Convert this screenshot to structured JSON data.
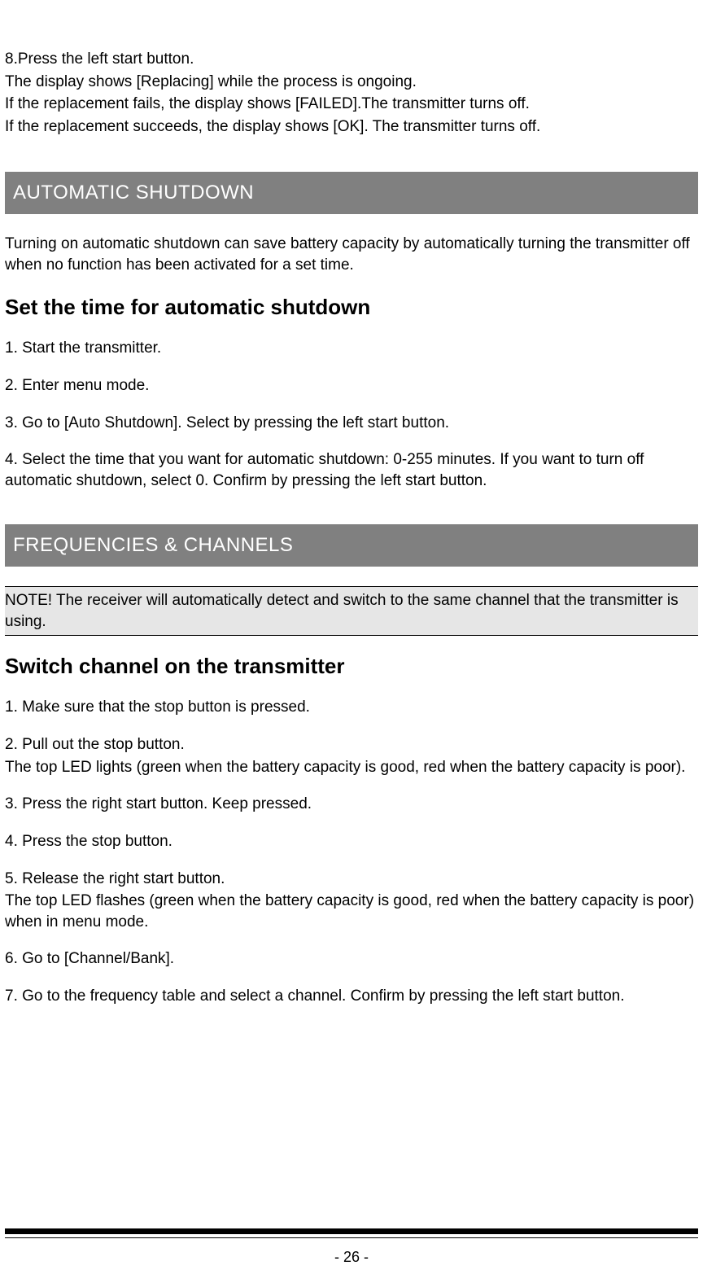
{
  "intro": {
    "lines": [
      "8.Press the left start button.",
      "The display shows [Replacing] while the process is ongoing.",
      "If the replacement fails, the display shows [FAILED].The transmitter turns off.",
      "If the replacement succeeds, the display shows [OK]. The transmitter turns off."
    ]
  },
  "section1": {
    "title": "AUTOMATIC SHUTDOWN",
    "lead": "Turning on automatic shutdown can save battery capacity by automatically turning the transmitter off when no function has been activated for a set time.",
    "sub": "Set the time for automatic shutdown",
    "steps": [
      "1. Start the transmitter.",
      "2. Enter menu mode.",
      "3. Go to [Auto Shutdown]. Select by pressing the left start button.",
      "4. Select the time that you want for automatic shutdown: 0-255 minutes. If you want to turn off automatic shutdown, select 0. Confirm by pressing the left start button."
    ]
  },
  "section2": {
    "title": "FREQUENCIES & CHANNELS",
    "note": "NOTE! The receiver will automatically detect and switch to the same channel that the transmitter is using.",
    "sub": "Switch channel on the transmitter",
    "steps": [
      {
        "text": "1. Make sure that the stop button is pressed."
      },
      {
        "text": "2. Pull out the stop button.",
        "after": "The top LED lights (green when the battery capacity is good, red when the battery capacity is poor)."
      },
      {
        "text": "3. Press the right start button. Keep pressed."
      },
      {
        "text": "4. Press the stop button."
      },
      {
        "text": "5. Release the right start button.",
        "after": "The top LED flashes (green when the battery capacity is good, red when the battery capacity is poor) when in menu mode."
      },
      {
        "text": "6. Go to [Channel/Bank]."
      },
      {
        "text": "7. Go to the frequency table and select a channel. Confirm by pressing the left start button."
      }
    ]
  },
  "page_number": "- 26 -"
}
